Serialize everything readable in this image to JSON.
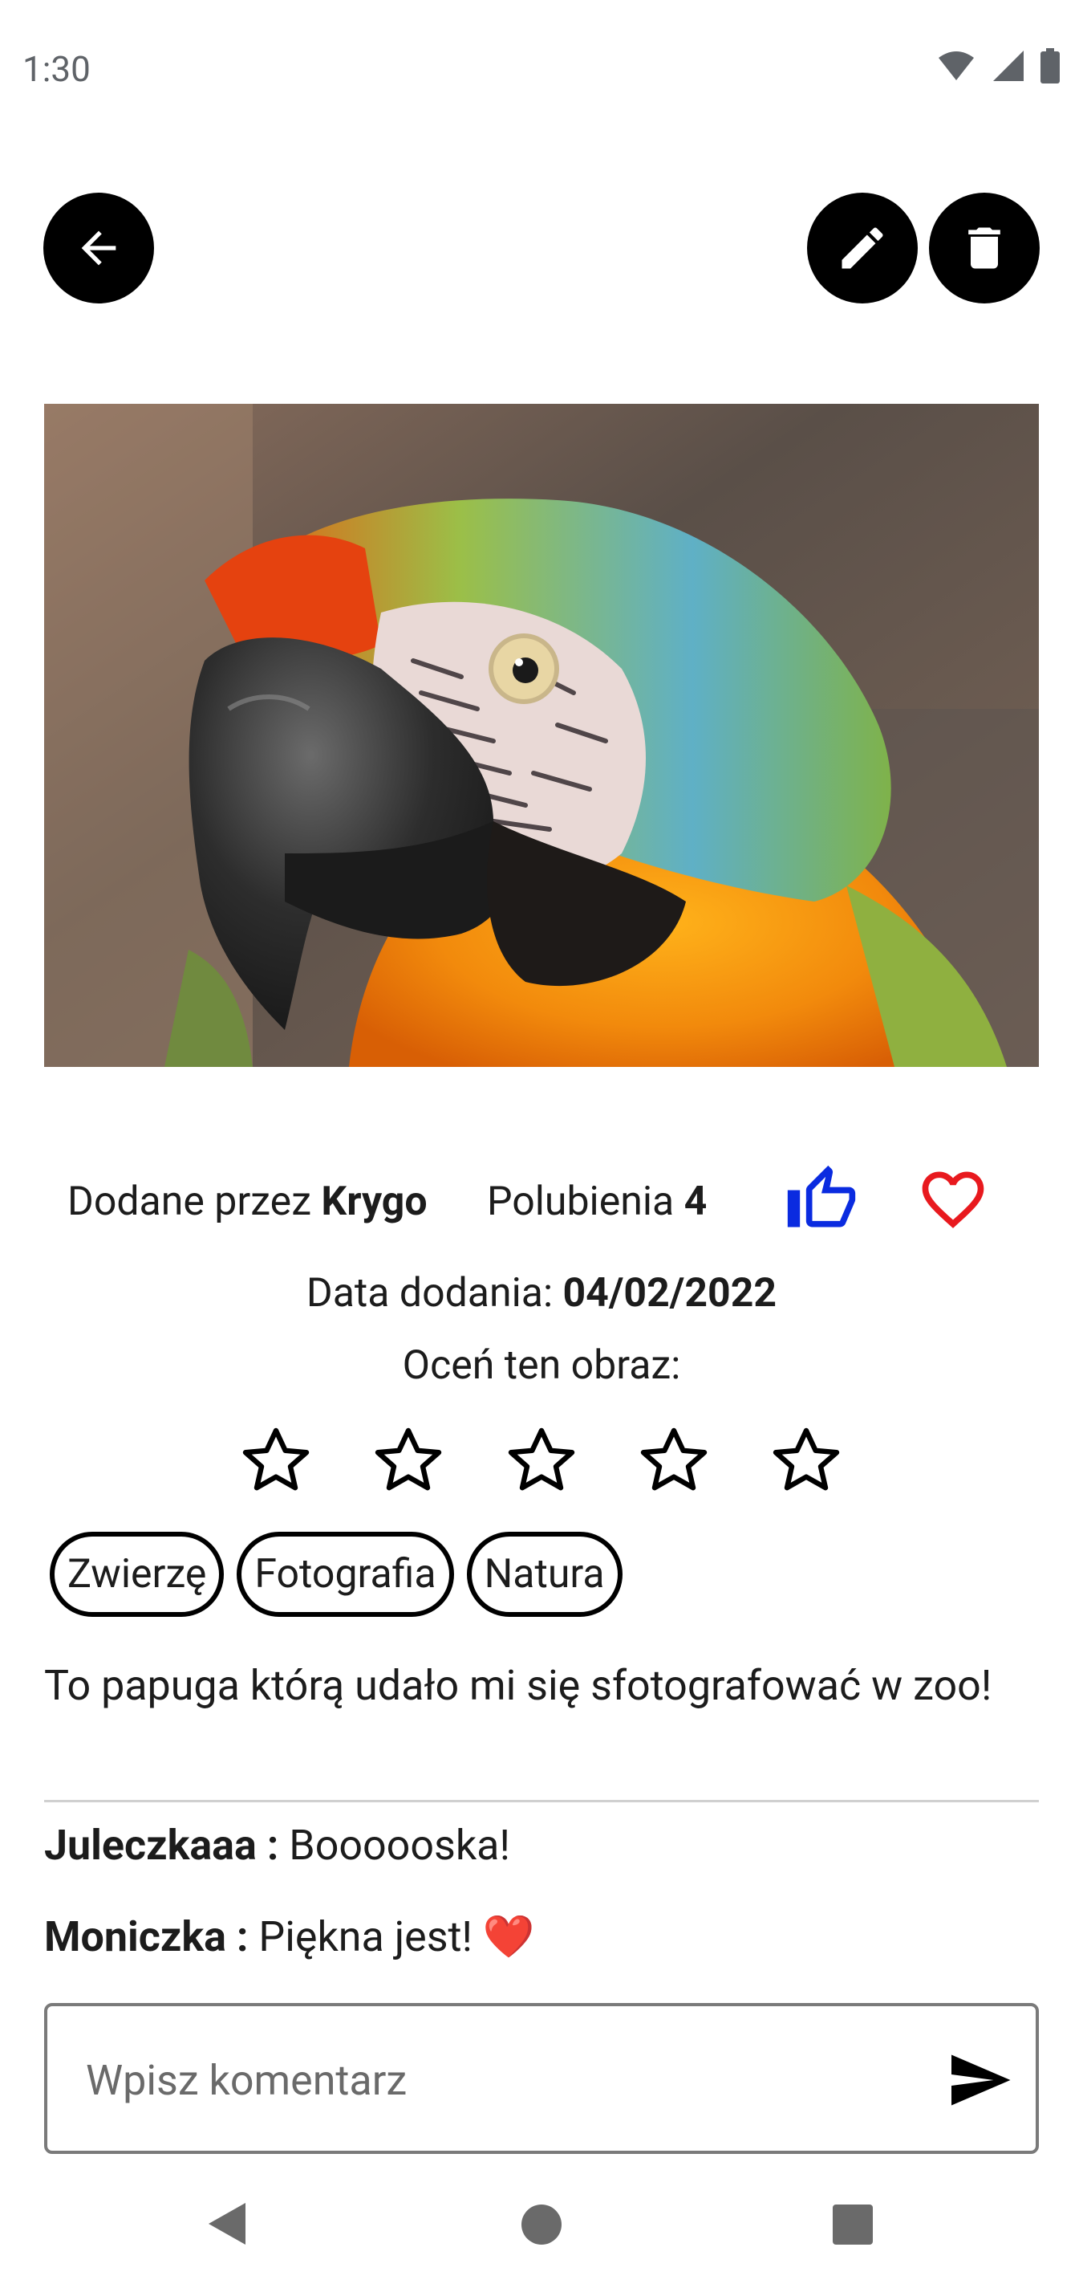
{
  "status_bar": {
    "time": "1:30",
    "icons": [
      "wifi-icon",
      "signal-icon",
      "battery-icon"
    ]
  },
  "toolbar": {
    "back_icon": "arrow-left-icon",
    "edit_icon": "pencil-icon",
    "delete_icon": "trash-icon"
  },
  "post": {
    "added_by_prefix": "Dodane przez ",
    "author": "Krygo",
    "likes_prefix": "Polubienia ",
    "likes_count": "4",
    "date_prefix": "Data dodania: ",
    "date": "04/02/2022",
    "rate_label": "Oceń ten obraz:",
    "rating": 0,
    "rating_max": 5,
    "tags": [
      "Zwierzę",
      "Fotografia",
      "Natura"
    ],
    "description": "To papuga którą udało mi się sfotografować w zoo!"
  },
  "comments": [
    {
      "author": "Juleczkaaa :",
      "text": " Boooooska!"
    },
    {
      "author": "Moniczka :",
      "text": " Piękna jest! ❤️"
    }
  ],
  "comment_input": {
    "placeholder": "Wpisz komentarz",
    "value": ""
  },
  "colors": {
    "like": "#0a2be0",
    "favorite": "#e8191e",
    "button_bg": "#000000"
  }
}
